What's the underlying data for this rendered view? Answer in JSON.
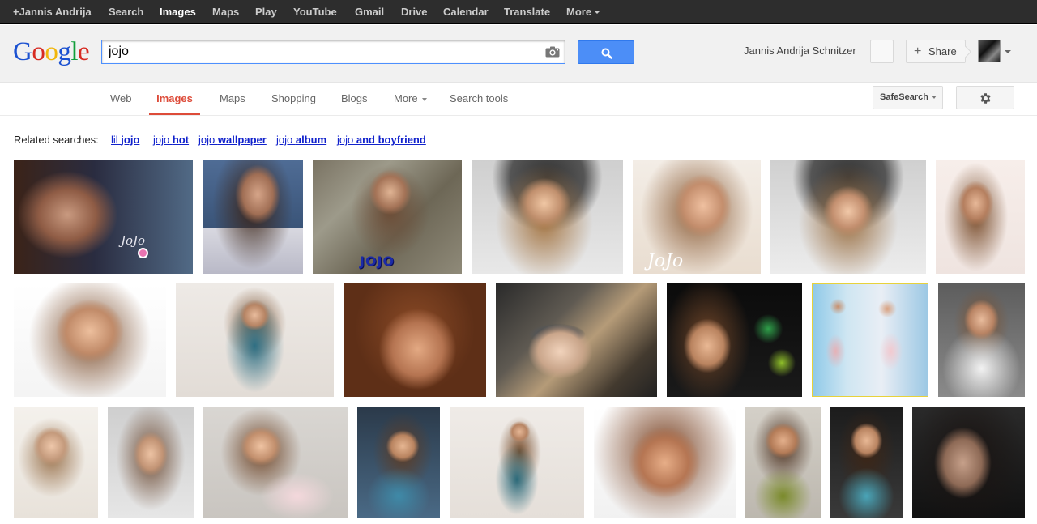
{
  "top_bar": {
    "items": [
      {
        "label": "+Jannis Andrija",
        "active": false
      },
      {
        "label": "Search",
        "active": false
      },
      {
        "label": "Images",
        "active": true
      },
      {
        "label": "Maps",
        "active": false
      },
      {
        "label": "Play",
        "active": false
      },
      {
        "label": "YouTube",
        "active": false
      },
      {
        "label": "Gmail",
        "active": false
      },
      {
        "label": "Drive",
        "active": false
      },
      {
        "label": "Calendar",
        "active": false
      },
      {
        "label": "Translate",
        "active": false
      },
      {
        "label": "More",
        "active": false
      }
    ]
  },
  "header": {
    "logo_letters": [
      "G",
      "o",
      "o",
      "g",
      "l",
      "e"
    ],
    "logo_colors": [
      "#1b51d1",
      "#d72b22",
      "#f1b60b",
      "#1b51d1",
      "#129e3a",
      "#d72b22"
    ],
    "search_value": "jojo",
    "camera_icon": "camera-icon",
    "search_icon": "search-icon",
    "user_name": "Jannis Andrija Schnitzer",
    "share_label": "Share",
    "share_plus": "+"
  },
  "nav": {
    "tabs": [
      {
        "label": "Web",
        "active": false
      },
      {
        "label": "Images",
        "active": true
      },
      {
        "label": "Maps",
        "active": false
      },
      {
        "label": "Shopping",
        "active": false
      },
      {
        "label": "Blogs",
        "active": false
      },
      {
        "label": "More",
        "active": false
      },
      {
        "label": "Search tools",
        "active": false
      }
    ],
    "safesearch_label": "SafeSearch",
    "settings_icon": "gear-icon"
  },
  "related": {
    "label": "Related searches:",
    "links": [
      {
        "prefix": "lil ",
        "bold": "jojo",
        "suffix": ""
      },
      {
        "prefix": "jojo ",
        "bold": "hot",
        "suffix": ""
      },
      {
        "prefix": "jojo ",
        "bold": "wallpaper",
        "suffix": ""
      },
      {
        "prefix": "jojo ",
        "bold": "album",
        "suffix": ""
      },
      {
        "prefix": "jojo ",
        "bold": "and boyfriend",
        "suffix": ""
      }
    ]
  },
  "image_overlay_text": {
    "jojo_logo": "JOJO",
    "script_signature": "JoJo"
  },
  "image_rows": [
    {
      "count": 7
    },
    {
      "count": 7
    },
    {
      "count": 9
    }
  ],
  "colors": {
    "accent_red": "#dd4b39",
    "link_blue": "#1122cc",
    "button_blue": "#4c8ef7",
    "top_bar_bg": "#2d2d2d"
  }
}
